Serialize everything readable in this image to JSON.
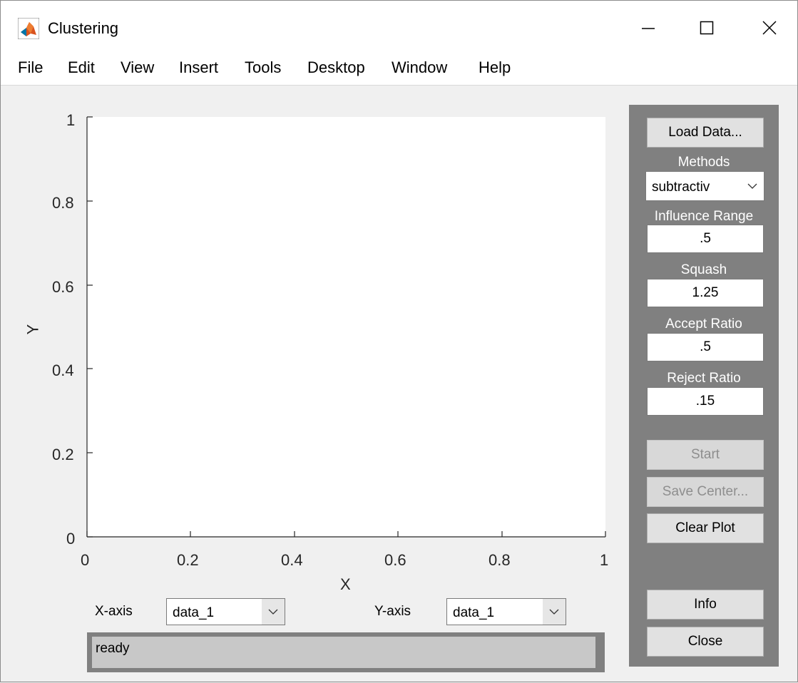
{
  "window": {
    "title": "Clustering",
    "icon": "matlab-icon"
  },
  "menu": [
    "File",
    "Edit",
    "View",
    "Insert",
    "Tools",
    "Desktop",
    "Window",
    "Help"
  ],
  "axes": {
    "xlabel": "X",
    "ylabel": "Y",
    "xlim": [
      0,
      1
    ],
    "ylim": [
      0,
      1
    ],
    "xticks": [
      "0",
      "0.2",
      "0.4",
      "0.6",
      "0.8",
      "1"
    ],
    "yticks": [
      "0",
      "0.2",
      "0.4",
      "0.6",
      "0.8",
      "1"
    ]
  },
  "bottom": {
    "xaxis_label": "X-axis",
    "xaxis_value": "data_1",
    "yaxis_label": "Y-axis",
    "yaxis_value": "data_1",
    "status": "ready"
  },
  "panel": {
    "load_data": "Load Data...",
    "methods_label": "Methods",
    "methods_value": "subtractiv",
    "influence_label": "Influence Range",
    "influence_value": ".5",
    "squash_label": "Squash",
    "squash_value": "1.25",
    "accept_label": "Accept Ratio",
    "accept_value": ".5",
    "reject_label": "Reject Ratio",
    "reject_value": ".15",
    "start": "Start",
    "save_center": "Save Center...",
    "clear_plot": "Clear Plot",
    "info": "Info",
    "close": "Close"
  },
  "colors": {
    "panel": "#808080",
    "status_bg": "#c8c8c8"
  }
}
